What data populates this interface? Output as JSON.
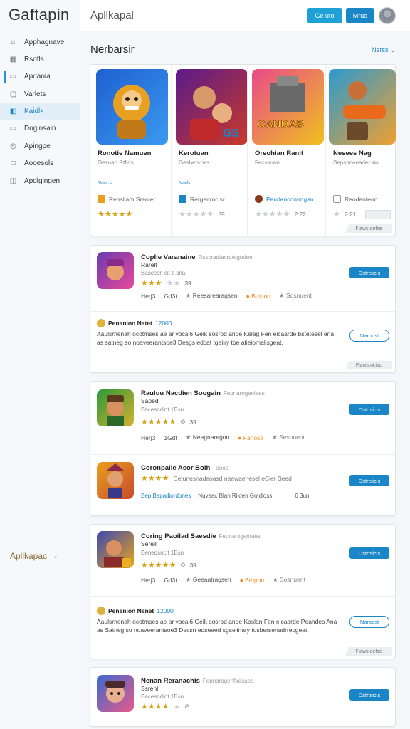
{
  "app": {
    "brand": "Gaftapin",
    "header_title": "Apllkapal"
  },
  "header": {
    "button1": "Ge uto",
    "button2": "Mrua"
  },
  "sidebar": {
    "items": [
      {
        "label": "Apphagnave",
        "icon": "home-icon"
      },
      {
        "label": "Rsofls",
        "icon": "grid-icon"
      },
      {
        "label": "Apdaoia",
        "icon": "card-icon"
      },
      {
        "label": "Varlets",
        "icon": "wallet-icon"
      },
      {
        "label": "Kaidlk",
        "icon": "book-icon"
      },
      {
        "label": "Doginsain",
        "icon": "folder-icon"
      },
      {
        "label": "Apingpe",
        "icon": "globe-icon"
      },
      {
        "label": "Aooesols",
        "icon": "square-icon"
      },
      {
        "label": "Apdlgingen",
        "icon": "bag-icon"
      }
    ],
    "footer_label": "Apllkapac"
  },
  "section": {
    "title": "Nerbarsir",
    "link": "Nerss"
  },
  "featured": [
    {
      "name": "Ronotie Namuen",
      "sub": "Gesnan Rtfids",
      "tag": "Nancs",
      "meta": "Rensliam Sreoler",
      "rating": "★★★★★",
      "count": "",
      "colors": [
        "#2b6fd6",
        "#e8a020"
      ]
    },
    {
      "name": "Kerotuan",
      "sub": "Gesbenrpes",
      "tag": "Nads",
      "meta": "Rergenroclsr",
      "rating": "★★★★★",
      "count": "39",
      "colors": [
        "#6a2aa0",
        "#d83a2a"
      ]
    },
    {
      "name": "Oreohian Ranit",
      "sub": "Fecssoan",
      "tag": "",
      "meta": "Peudenconongan",
      "rating": "★★★★★",
      "count": "2:22",
      "colors": [
        "#e84a8a",
        "#f0c020"
      ]
    },
    {
      "name": "Nesees Nag",
      "sub": "Sepsnnenadecsio",
      "tag": "",
      "meta": "Reodenteon",
      "rating": "★",
      "count": "2:21",
      "colors": [
        "#2a9ad0",
        "#e86a1a"
      ]
    }
  ],
  "featured_footer": "Fiaws oefse",
  "groups": [
    {
      "rows": [
        {
          "type": "app",
          "name": "Coplie Varanaine",
          "desc": "Rsscradtacrdtegoden",
          "sub": "Rarelt",
          "size": "Bascesn cit tl sna",
          "stars": "★★★",
          "count": "39",
          "meta": [
            "Herj3",
            "Gd3t",
            "Reesarearagsen",
            "Btripon",
            "Sosnuent"
          ],
          "button": "Dstrtsicis",
          "colors": [
            "#6a3ab0",
            "#e84a9a"
          ]
        },
        {
          "type": "review",
          "title": "Penanion Natet",
          "title_extra": "12000",
          "text": "Aaulsrnenah ocotmses ae ar vocal6 Geik sosrod ande Kelag Fen eicaarde bstetesel ena as satneg so noaveerantsoe3 Desgs edcat tgeiiry tbe atieiomalisgeat.",
          "button": "Naroost"
        }
      ],
      "footer": "Fiaws ocisc"
    },
    {
      "rows": [
        {
          "type": "app",
          "name": "Rauluu Nacdien Soogain",
          "desc": "Fepnarogeniaes",
          "sub": "Sapedl",
          "size": "Bacesndint 1Bsn",
          "stars": "★★★★★",
          "count": "39",
          "meta": [
            "Herj3",
            "1Gdt",
            "Neagnaregon",
            "Fanosa",
            "Sesnuent"
          ],
          "button": "Dstrtsicis",
          "colors": [
            "#2a9a3a",
            "#d8b030"
          ]
        },
        {
          "type": "app2",
          "name": "Coronpalie Aeor Bolh",
          "desc": "I sooo",
          "sub": "",
          "size": "",
          "stars": "★★★★",
          "count": "",
          "extra": "Detunesnadeoasd naewaenesel eCier Seed",
          "links": [
            "Bep Bepadiordones",
            "Nuveac Blan Riiden Gmdloss"
          ],
          "linksize": "6 3un",
          "button": "Dstrtsicis",
          "colors": [
            "#e8a020",
            "#c84a2a"
          ]
        }
      ],
      "footer": ""
    },
    {
      "rows": [
        {
          "type": "app",
          "name": "Coring Paoilad Saesdie",
          "desc": "Fepnarogenfaes",
          "sub": "Serell",
          "size": "Benedsncit 1Bsn",
          "stars": "★★★★★",
          "count": "39",
          "meta": [
            "Herj3",
            "Gd3t",
            "Geeaatragsen",
            "Btripon",
            "Sosnuent"
          ],
          "button": "Dstrtsicis",
          "colors": [
            "#3a4ab0",
            "#e8a020"
          ]
        },
        {
          "type": "review",
          "title": "Penenlon Nenet",
          "title_extra": "12000",
          "text": "Aaulsrnenah ocotmses ae ar vocal6 Geik sosrod ande Kaslan Fen eicaarde Peandes Ana as Satneg so noaveerantsoe3 Decsn edseaed sgseiinary tosbersenadrrecgeet.",
          "button": "Naroost"
        }
      ],
      "footer": "Fiaws oefse"
    },
    {
      "rows": [
        {
          "type": "app",
          "name": "Nenan Reranachis",
          "desc": "Fepnarogenfaesaes",
          "sub": "Ssrenl",
          "size": "Bacesndint 1Bsn",
          "stars": "★★★★",
          "count": "",
          "meta": [],
          "button": "Dstrtsicis",
          "colors": [
            "#3a6ad0",
            "#e85a8a"
          ]
        }
      ],
      "footer": ""
    }
  ]
}
